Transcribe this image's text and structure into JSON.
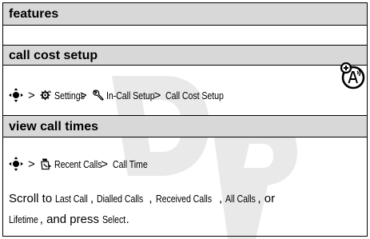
{
  "table": {
    "header": "features",
    "section1": {
      "title": "call cost setup",
      "path": [
        "Settings",
        "In-Call Setup",
        "Call Cost Setup"
      ],
      "separator": ">",
      "icons": [
        "nav-key-icon",
        "settings-gear-icon",
        "in-call-wrench-icon",
        "network-feature-icon"
      ]
    },
    "section2": {
      "title": "view call times",
      "path": [
        "Recent Calls",
        "Call Time"
      ],
      "separator": ">",
      "icons": [
        "nav-key-icon",
        "recent-calls-icon"
      ],
      "text": {
        "p1": "Scroll to ",
        "t1": "Last Call",
        "p2": ", ",
        "t2": "Dialled Calls",
        "p3": ", ",
        "t3": "Received Calls",
        "p4": ", ",
        "t4": "All Calls",
        "p5": ", or",
        "t5": "Lifetime",
        "p6": ", and press ",
        "t6": "Select",
        "p7": "."
      }
    }
  },
  "watermark": "DRAFT",
  "colors": {
    "header_bg": "#d8d8d8",
    "border": "#000000",
    "watermark": "#e6e6e6"
  }
}
